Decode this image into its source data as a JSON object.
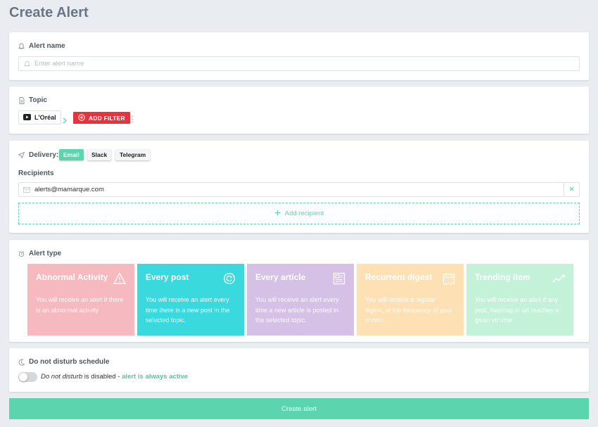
{
  "page": {
    "title": "Create Alert"
  },
  "alert_name": {
    "label": "Alert name",
    "placeholder": "Enter alert name"
  },
  "topic": {
    "label": "Topic",
    "brand": "L'Oréal",
    "add_filter": "ADD FILTER"
  },
  "delivery": {
    "label": "Delivery:",
    "channels": [
      "Email",
      "Slack",
      "Telegram"
    ],
    "active_channel": "Email",
    "recipients_label": "Recipients",
    "recipient_email": "alerts@mamarque.com",
    "add_recipient": "Add recipient"
  },
  "alert_type": {
    "label": "Alert type",
    "types": [
      {
        "title": "Abnormal Activity",
        "desc": "You will receive an alert if there is an abnormal activity",
        "color": "#f6b9c0",
        "icon": "warning-icon"
      },
      {
        "title": "Every post",
        "desc": "You will receive an alert every time there is a new post in the selected topic.",
        "color": "#3ad9de",
        "icon": "refresh-icon"
      },
      {
        "title": "Every article",
        "desc": "You will receive an alert every time a new article is posted in the selected topic.",
        "color": "#d5c0e6",
        "icon": "newspaper-icon"
      },
      {
        "title": "Recurrent digest",
        "desc": "You will receive a regular digest, at the frequency of your choice",
        "color": "#fde1b4",
        "icon": "calendar-icon"
      },
      {
        "title": "Trending item",
        "desc": "You will receive an alert if any post, hashtag or url reaches a given volume",
        "color": "#c3f2d8",
        "icon": "trend-icon"
      }
    ]
  },
  "dnd": {
    "label": "Do not disturb schedule",
    "text_italic": "Do not disturb",
    "text_mid": " is disabled - ",
    "text_status": "alert is always active",
    "enabled": false
  },
  "submit": {
    "label": "Create alert"
  },
  "colors": {
    "accent": "#5cd4ad",
    "danger": "#e8333d"
  }
}
